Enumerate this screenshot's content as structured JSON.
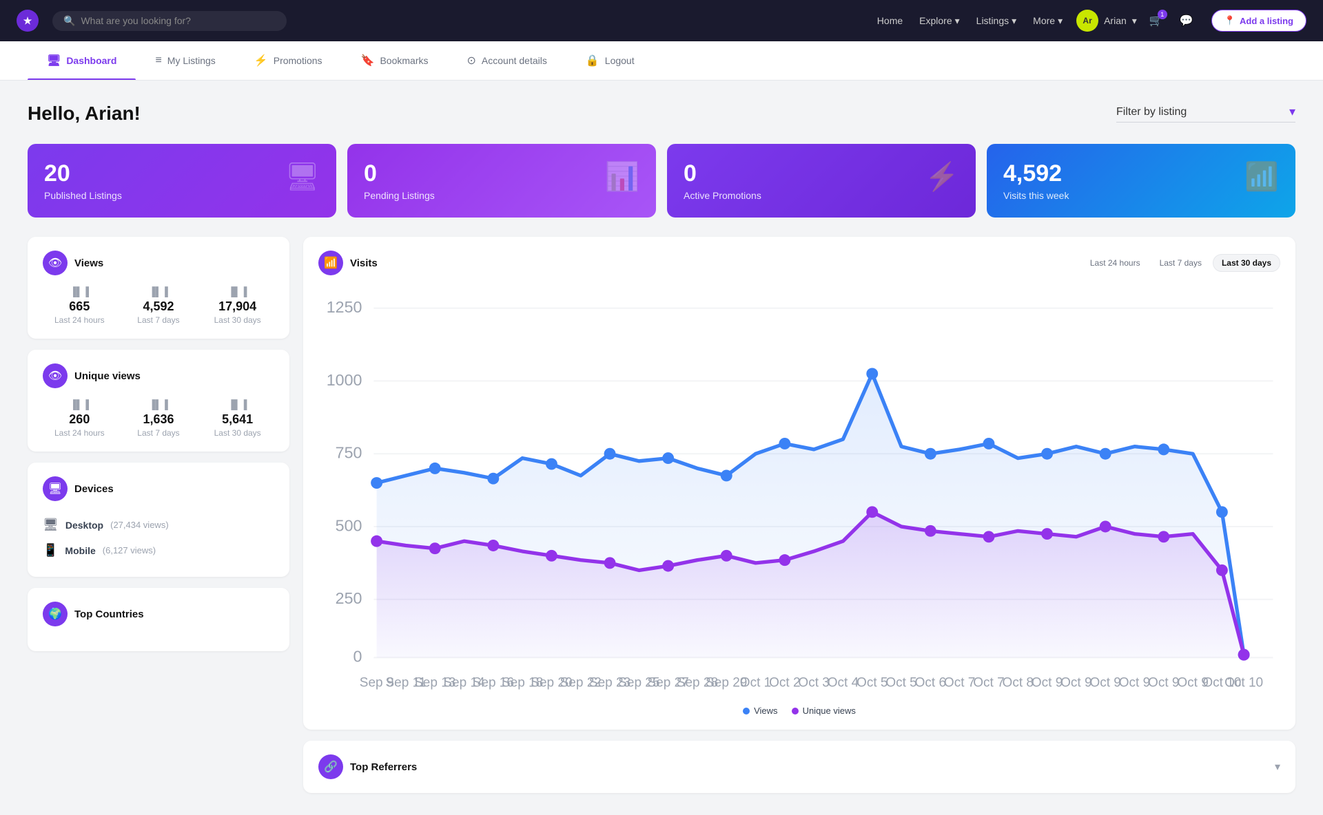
{
  "navbar": {
    "logo_text": "★",
    "search_placeholder": "What are you looking for?",
    "nav_links": [
      {
        "label": "Home",
        "has_dropdown": false
      },
      {
        "label": "Explore",
        "has_dropdown": true
      },
      {
        "label": "Listings",
        "has_dropdown": true
      },
      {
        "label": "More",
        "has_dropdown": true
      }
    ],
    "user": {
      "avatar_initials": "Ar",
      "name": "Arian"
    },
    "cart_badge": "1",
    "add_listing_label": "Add a listing"
  },
  "subnav": {
    "tabs": [
      {
        "label": "Dashboard",
        "active": true,
        "icon": "🖥"
      },
      {
        "label": "My Listings",
        "active": false,
        "icon": "≡"
      },
      {
        "label": "Promotions",
        "active": false,
        "icon": "⚡"
      },
      {
        "label": "Bookmarks",
        "active": false,
        "icon": "🔖"
      },
      {
        "label": "Account details",
        "active": false,
        "icon": "⊙"
      },
      {
        "label": "Logout",
        "active": false,
        "icon": "🔒"
      }
    ]
  },
  "page": {
    "greeting": "Hello, Arian!",
    "filter_label": "Filter by listing"
  },
  "stat_cards": [
    {
      "number": "20",
      "label": "Published Listings",
      "icon": "🖥",
      "color": "card-purple"
    },
    {
      "number": "0",
      "label": "Pending Listings",
      "icon": "📊",
      "color": "card-violet"
    },
    {
      "number": "0",
      "label": "Active Promotions",
      "icon": "⚡",
      "color": "card-grape"
    },
    {
      "number": "4,592",
      "label": "Visits this week",
      "icon": "📶",
      "color": "card-blue"
    }
  ],
  "views_widget": {
    "title": "Views",
    "stats": [
      {
        "value": "665",
        "label": "Last 24 hours"
      },
      {
        "value": "4,592",
        "label": "Last 7 days"
      },
      {
        "value": "17,904",
        "label": "Last 30 days"
      }
    ]
  },
  "unique_views_widget": {
    "title": "Unique views",
    "stats": [
      {
        "value": "260",
        "label": "Last 24 hours"
      },
      {
        "value": "1,636",
        "label": "Last 7 days"
      },
      {
        "value": "5,641",
        "label": "Last 30 days"
      }
    ]
  },
  "devices_widget": {
    "title": "Devices",
    "items": [
      {
        "device": "Desktop",
        "count": "27,434 views"
      },
      {
        "device": "Mobile",
        "count": "6,127 views"
      }
    ]
  },
  "top_countries_widget": {
    "title": "Top Countries"
  },
  "visits_chart": {
    "title": "Visits",
    "time_filters": [
      "Last 24 hours",
      "Last 7 days",
      "Last 30 days"
    ],
    "active_filter": "Last 30 days",
    "y_labels": [
      "1250",
      "1000",
      "750",
      "500",
      "250",
      "0"
    ],
    "legend": [
      {
        "label": "Views",
        "color": "#3b82f6"
      },
      {
        "label": "Unique views",
        "color": "#9333ea"
      }
    ]
  },
  "referrers_widget": {
    "title": "Top Referrers"
  }
}
